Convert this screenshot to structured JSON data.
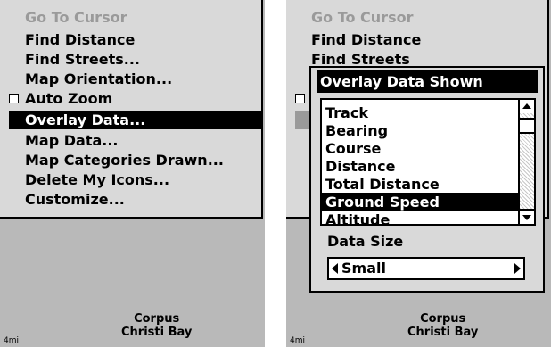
{
  "left_screen": {
    "menu_items": [
      {
        "label": "Go To Cursor",
        "state": "disabled"
      },
      {
        "label": "Find Distance",
        "state": "normal"
      },
      {
        "label": "Find Streets...",
        "state": "normal"
      },
      {
        "label": "Map Orientation...",
        "state": "normal"
      },
      {
        "label": "Auto Zoom",
        "state": "checkbox"
      },
      {
        "label": "Overlay Data...",
        "state": "selected"
      },
      {
        "label": "Map Data...",
        "state": "normal"
      },
      {
        "label": "Map Categories Drawn...",
        "state": "normal"
      },
      {
        "label": "Delete My Icons...",
        "state": "normal"
      },
      {
        "label": "Customize...",
        "state": "normal"
      }
    ],
    "map_label_line1": "Corpus",
    "map_label_line2": "Christi Bay",
    "scale": "4mi"
  },
  "right_screen": {
    "background_items": [
      {
        "label": "Go To Cursor",
        "state": "disabled"
      },
      {
        "label": "Find Distance",
        "state": "normal"
      },
      {
        "label": "Find Streets",
        "state": "normal"
      }
    ],
    "dialog": {
      "title": "Overlay Data Shown",
      "list_items": [
        "Track",
        "Bearing",
        "Course",
        "Distance",
        "Total Distance",
        "Ground Speed",
        "Altitude"
      ],
      "selected_item": "Ground Speed",
      "data_size_label": "Data Size",
      "data_size_value": "Small"
    },
    "map_label_line1": "Corpus",
    "map_label_line2": "Christi Bay",
    "scale": "4mi"
  },
  "colors": {
    "menu_bg": "#d9d9d9",
    "map_bg": "#b9b9b9",
    "selection": "#000000",
    "disabled_text": "#9a9a9a"
  }
}
